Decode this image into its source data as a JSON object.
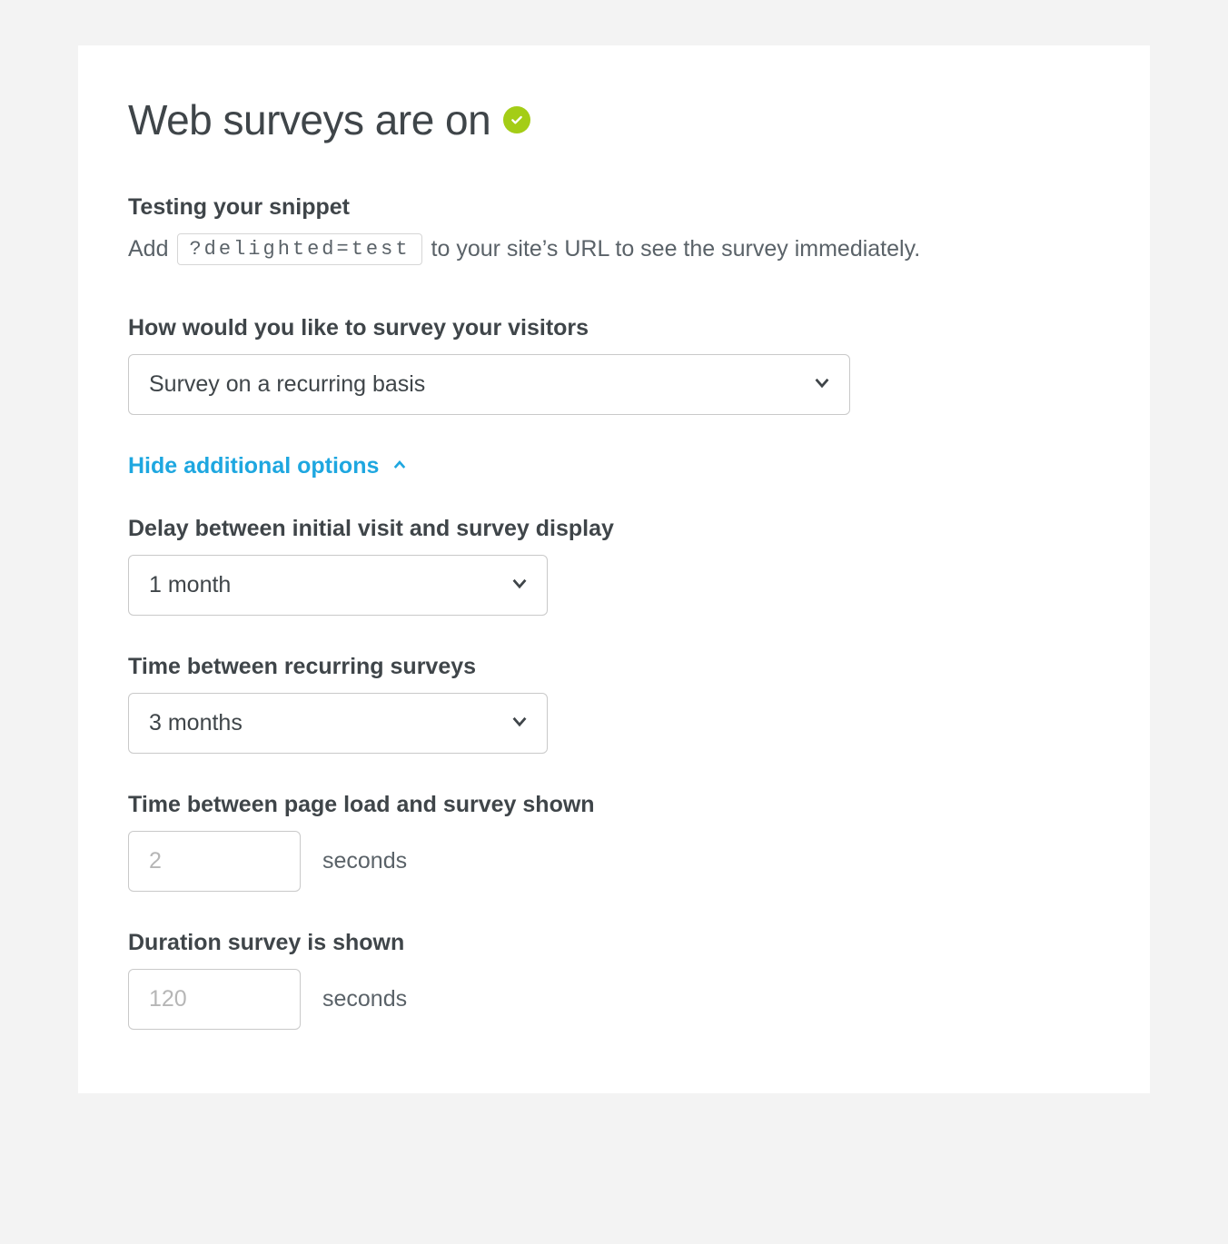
{
  "header": {
    "title": "Web surveys are on"
  },
  "testing": {
    "heading": "Testing your snippet",
    "prefix": "Add",
    "code": "?delighted=test",
    "suffix": "to your site’s URL to see the survey immediately."
  },
  "survey_method": {
    "label": "How would you like to survey your visitors",
    "value": "Survey on a recurring basis"
  },
  "toggle": {
    "label": "Hide additional options"
  },
  "delay_initial": {
    "label": "Delay between initial visit and survey display",
    "value": "1 month"
  },
  "time_between_recurring": {
    "label": "Time between recurring surveys",
    "value": "3 months"
  },
  "page_load_delay": {
    "label": "Time between page load and survey shown",
    "placeholder": "2",
    "unit": "seconds"
  },
  "duration_shown": {
    "label": "Duration survey is shown",
    "placeholder": "120",
    "unit": "seconds"
  }
}
